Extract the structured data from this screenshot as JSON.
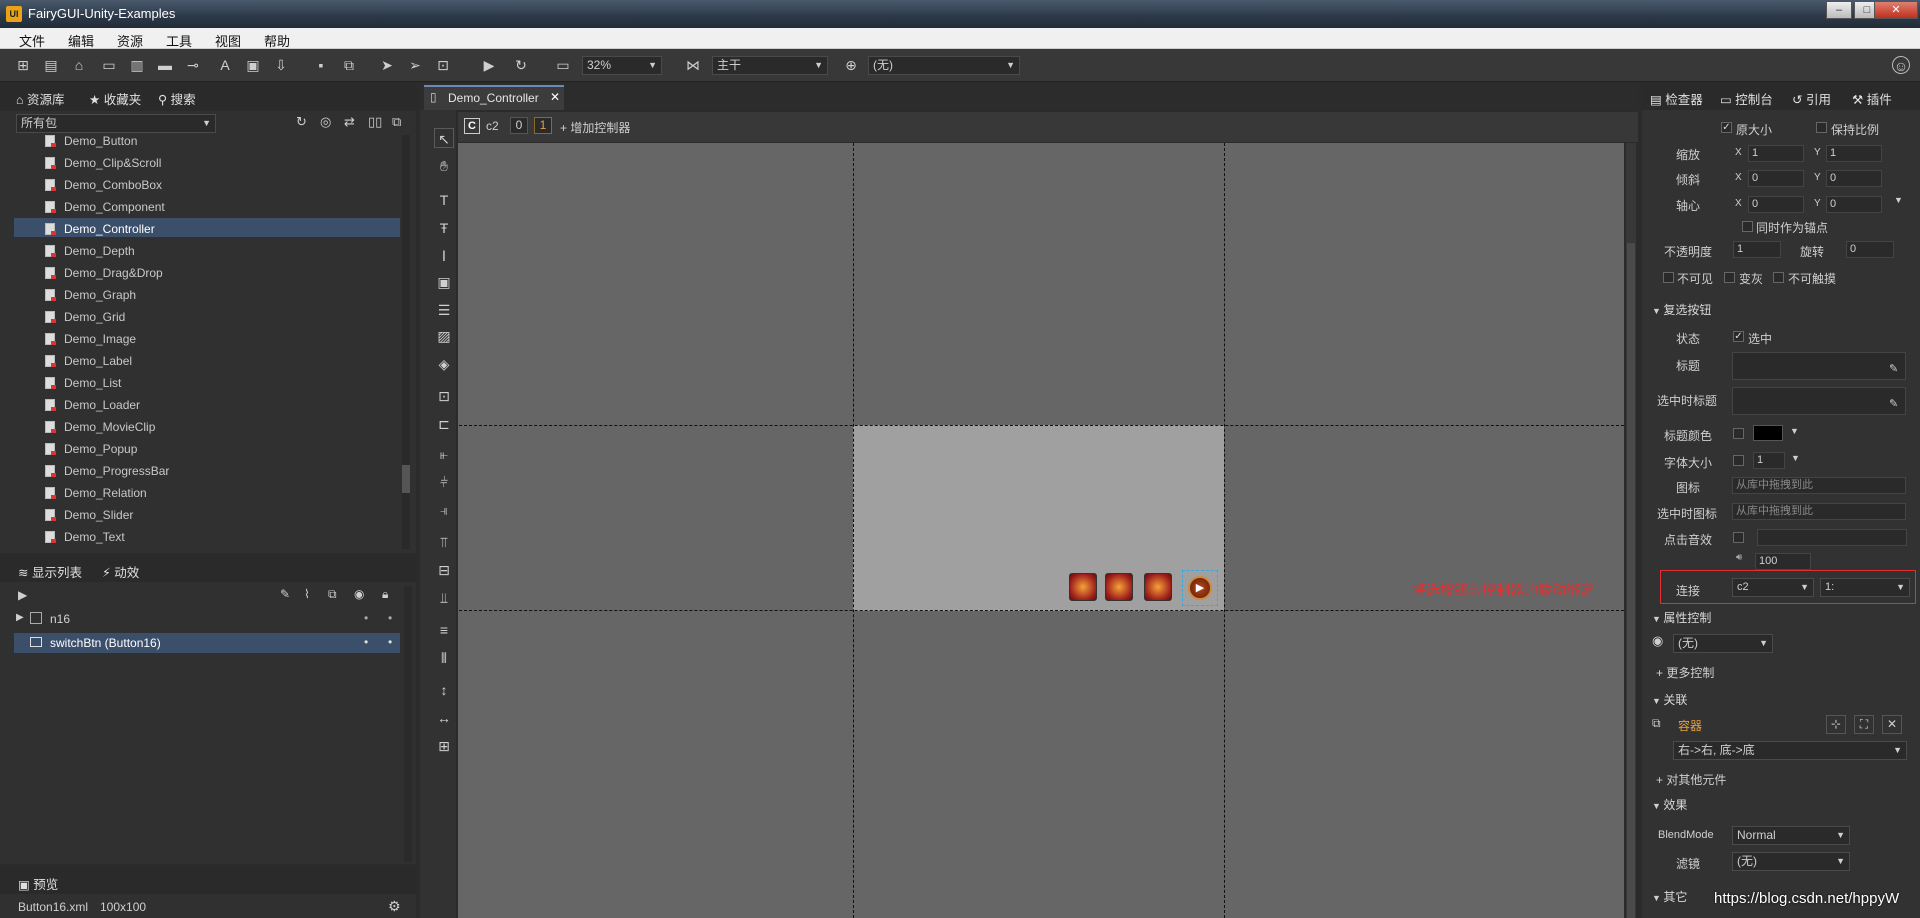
{
  "window": {
    "title": "FairyGUI-Unity-Examples",
    "logo_text": "UI"
  },
  "menu": [
    "文件",
    "编辑",
    "资源",
    "工具",
    "视图",
    "帮助"
  ],
  "toolbar": {
    "zoom": "32%",
    "branch": "主干",
    "language": "(无)"
  },
  "library": {
    "tabs": [
      "资源库",
      "收藏夹",
      "搜索"
    ],
    "package_filter": "所有包",
    "items": [
      "Demo_Button",
      "Demo_Clip&Scroll",
      "Demo_ComboBox",
      "Demo_Component",
      "Demo_Controller",
      "Demo_Depth",
      "Demo_Drag&Drop",
      "Demo_Graph",
      "Demo_Grid",
      "Demo_Image",
      "Demo_Label",
      "Demo_List",
      "Demo_Loader",
      "Demo_MovieClip",
      "Demo_Popup",
      "Demo_ProgressBar",
      "Demo_Relation",
      "Demo_Slider",
      "Demo_Text"
    ],
    "selected_index": 4
  },
  "display_list": {
    "tabs": [
      "显示列表",
      "动效"
    ],
    "items": [
      "n16",
      "switchBtn (Button16)"
    ],
    "selected_index": 1
  },
  "preview": {
    "tab": "预览",
    "file": "Button16.xml",
    "size": "100x100"
  },
  "stage": {
    "doc_tab": "Demo_Controller",
    "controller_badge": "C",
    "controller_name": "c2",
    "page0": "0",
    "page1": "1",
    "add_controller": "增加控制器",
    "annotation": "将选按钮与控制器的联动绑定",
    "annotation_color": "#e03030"
  },
  "inspector": {
    "tabs": [
      "检查器",
      "控制台",
      "引用",
      "插件"
    ],
    "original_size": "原大小",
    "keep_ratio": "保持比例",
    "scale_label": "缩放",
    "scale_x": "1",
    "scale_y": "1",
    "skew_label": "倾斜",
    "skew_x": "0",
    "skew_y": "0",
    "pivot_label": "轴心",
    "pivot_x": "0",
    "pivot_y": "0",
    "as_anchor": "同时作为锚点",
    "opacity_label": "不透明度",
    "opacity": "1",
    "rotation_label": "旋转",
    "rotation": "0",
    "invisible": "不可见",
    "grayed": "变灰",
    "untouchable": "不可触摸",
    "x_label": "X",
    "y_label": "Y",
    "checkbox_section": "复选按钮",
    "state_label": "状态",
    "state_value": "选中",
    "title_label": "标题",
    "selected_title_label": "选中时标题",
    "title_color_label": "标题颜色",
    "font_size_label": "字体大小",
    "font_size": "1",
    "icon_label": "图标",
    "icon_placeholder": "从库中拖拽到此",
    "selected_icon_label": "选中时图标",
    "selected_icon_placeholder": "从库中拖拽到此",
    "click_sound_label": "点击音效",
    "volume": "100",
    "link_label": "连接",
    "link_controller": "c2",
    "link_page": "1:",
    "prop_control_section": "属性控制",
    "prop_control_value": "(无)",
    "more_control": "更多控制",
    "relation_section": "关联",
    "relation_target": "容器",
    "relation_value": "右->右, 底->底",
    "other_element": "对其他元件",
    "effect_section": "效果",
    "blend_label": "BlendMode",
    "blend_value": "Normal",
    "filter_label": "滤镜",
    "filter_value": "(无)",
    "other_section": "其它"
  },
  "watermark": "https://blog.csdn.net/hppyW"
}
